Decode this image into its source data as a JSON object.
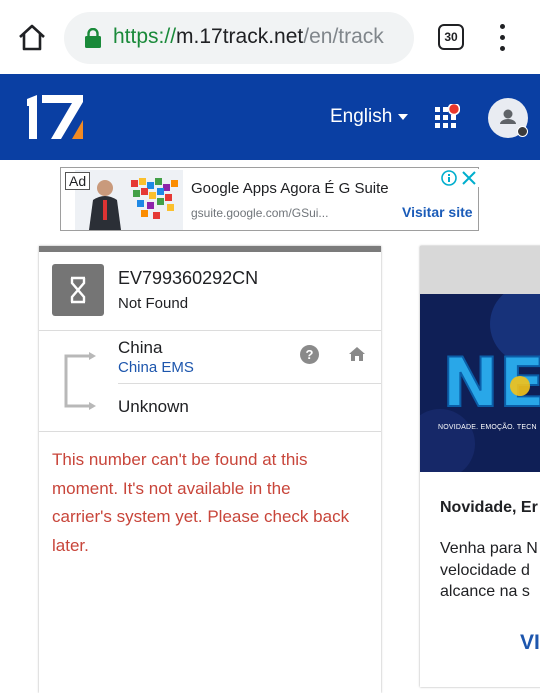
{
  "browser": {
    "url_scheme": "https://",
    "url_host": "m.17track.net",
    "url_path": "/en/track",
    "tab_count": "30"
  },
  "header": {
    "logo_text": "17",
    "language": "English",
    "brand_color": "#0a3fa3",
    "accent_color": "#f08a24"
  },
  "ad": {
    "label": "Ad",
    "title": "Google Apps Agora É G Suite",
    "url": "gsuite.google.com/GSui...",
    "cta": "Visitar site"
  },
  "tracking": {
    "number": "EV799360292CN",
    "status": "Not Found",
    "origin_country": "China",
    "origin_carrier": "China EMS",
    "destination_country": "Unknown",
    "help_symbol": "?",
    "message": "This number can't be found at this moment. It's not available in the carrier's system yet. Please check back later.",
    "message_color": "#c8453a"
  },
  "promo": {
    "banner_word": "NE",
    "tagline": "NOVIDADE. EMOÇÃO. TECN",
    "title": "Novidade, Er",
    "body_lines": [
      "Venha para N",
      "velocidade d",
      "alcance na s"
    ],
    "cta": "VI"
  }
}
